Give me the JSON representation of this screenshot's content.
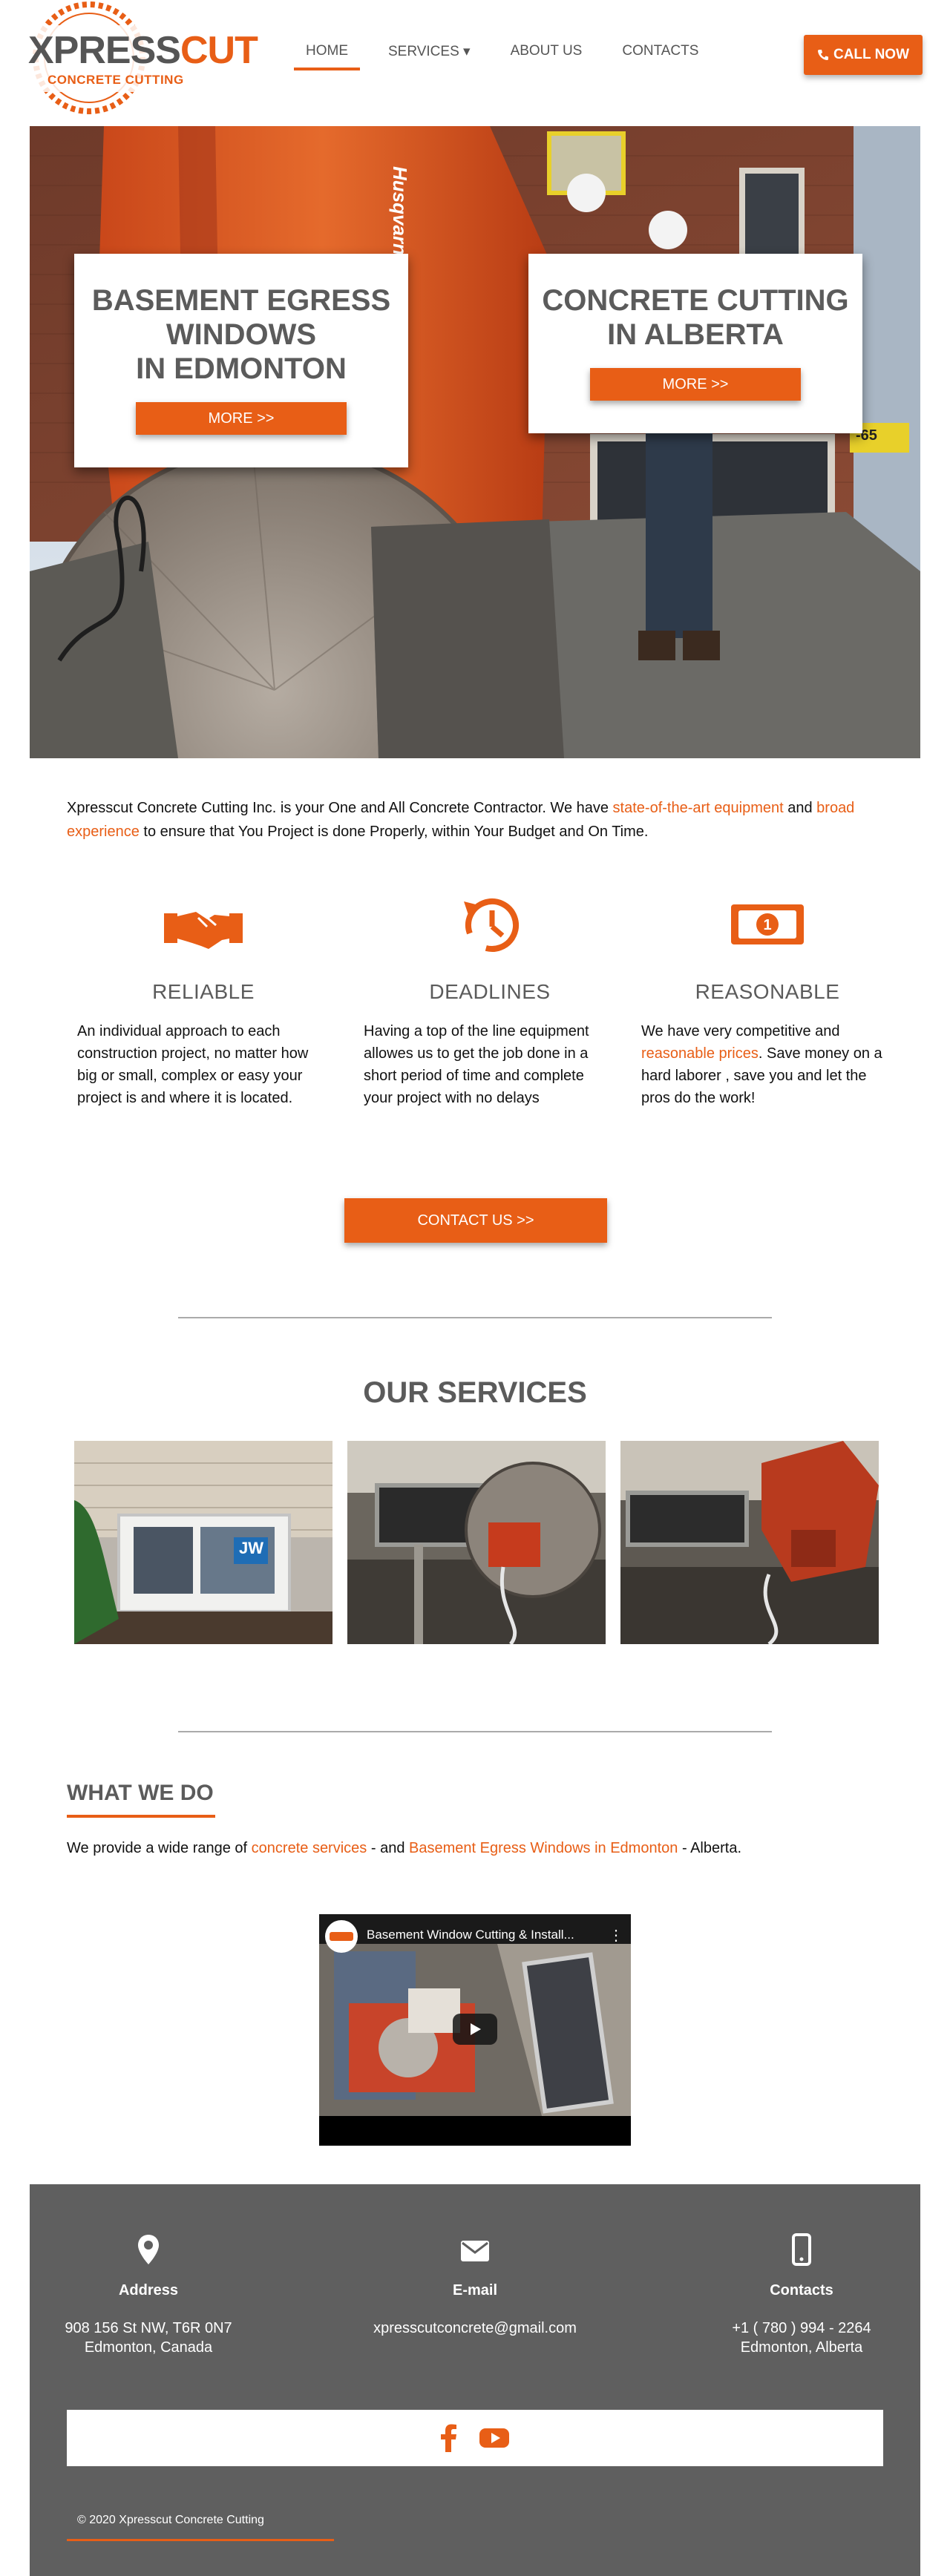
{
  "brand": {
    "name_left": "XPRESS",
    "name_right": "CUT",
    "tagline": "CONCRETE CUTTING",
    "colors": {
      "accent": "#e85e16",
      "heading": "#5b5b5b",
      "footer_bg": "#5f5f5f"
    }
  },
  "nav": {
    "items": [
      {
        "label": "HOME",
        "active": true
      },
      {
        "label": "SERVICES ▾",
        "active": false
      },
      {
        "label": "ABOUT US",
        "active": false
      },
      {
        "label": "CONTACTS",
        "active": false
      }
    ],
    "call_label": "CALL NOW",
    "call_icon": "phone-icon"
  },
  "hero": {
    "card_left": {
      "title_lines": [
        "BASEMENT EGRESS",
        "WINDOWS",
        "IN EDMONTON"
      ],
      "button": "MORE >>"
    },
    "card_right": {
      "title_lines": [
        "CONCRETE CUTTING",
        "IN ALBERTA"
      ],
      "button": "MORE >>"
    },
    "saw_brand": "Husqvarna",
    "sign_text": "-65"
  },
  "intro": {
    "part1": "Xpresscut Concrete Cutting Inc. is your One and All Concrete Contractor. We have ",
    "link1": "state-of-the-art equipment",
    "part2": " and ",
    "link2": "broad experience",
    "part3": " to ensure that You Project is done Properly, within Your Budget and On Time."
  },
  "features": [
    {
      "icon": "handshake-icon",
      "title": "RELIABLE",
      "text": "An individual approach to each construction project, no matter how big or small, complex or easy your project is and where it is located."
    },
    {
      "icon": "clock-history-icon",
      "title": "DEADLINES",
      "text": "Having a top of the line equipment allowes us to get the job done in a short period of time and complete your project with no delays"
    },
    {
      "icon": "money-bill-icon",
      "title": "REASONABLE",
      "pre": "We have very competitive and ",
      "link": "reasonable prices",
      "post": ". Save money on a hard laborer , save you and let the pros do the work!"
    }
  ],
  "contact_button": "CONTACT US >>",
  "services": {
    "title": "OUR SERVICES",
    "window_sign": "JW"
  },
  "what_we_do": {
    "title": "WHAT WE DO",
    "part1": "We provide a wide range of ",
    "link1": "concrete services",
    "part2": " - and ",
    "link2": "Basement Egress Windows in Edmonton",
    "part3": " - Alberta."
  },
  "video": {
    "title": "Basement Window Cutting & Install...",
    "menu": "⋮",
    "play_icon": "play-icon"
  },
  "footer": {
    "columns": [
      {
        "icon": "map-pin-icon",
        "label": "Address",
        "lines": [
          "908 156 St NW, T6R 0N7",
          "Edmonton, Canada"
        ]
      },
      {
        "icon": "envelope-icon",
        "label": "E-mail",
        "lines": [
          "xpresscutconcrete@gmail.com"
        ]
      },
      {
        "icon": "mobile-phone-icon",
        "label": "Contacts",
        "lines": [
          "+1 ( 780 ) 994 - 2264",
          "Edmonton, Alberta"
        ]
      }
    ],
    "social": [
      "facebook-icon",
      "youtube-icon"
    ],
    "copyright": "© 2020 Xpresscut Concrete Cutting"
  }
}
